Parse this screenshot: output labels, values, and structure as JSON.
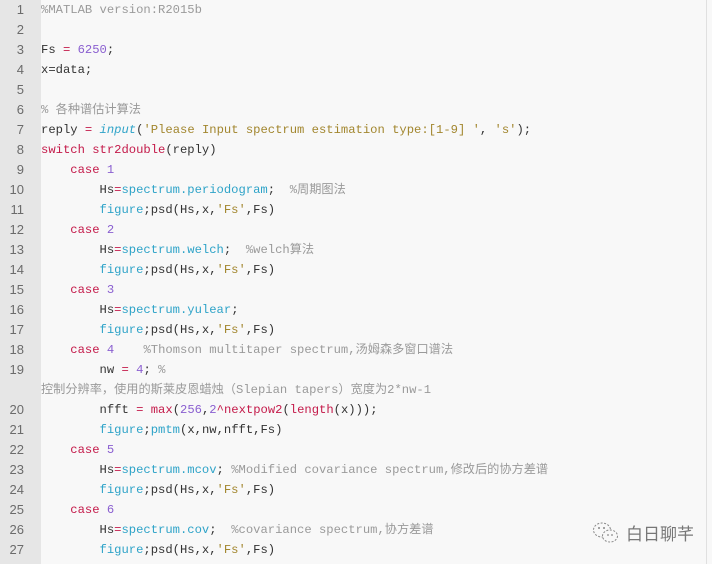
{
  "lines": [
    {
      "n": "1",
      "tokens": [
        [
          "com",
          "%MATLAB version:R2015b"
        ]
      ]
    },
    {
      "n": "2",
      "tokens": []
    },
    {
      "n": "3",
      "tokens": [
        [
          "txt",
          "Fs "
        ],
        [
          "op",
          "="
        ],
        [
          "txt",
          " "
        ],
        [
          "num",
          "6250"
        ],
        [
          "txt",
          ";"
        ]
      ]
    },
    {
      "n": "4",
      "tokens": [
        [
          "txt",
          "x=data;"
        ]
      ]
    },
    {
      "n": "5",
      "tokens": []
    },
    {
      "n": "6",
      "tokens": [
        [
          "com",
          "% 各种谱估计算法"
        ]
      ]
    },
    {
      "n": "7",
      "tokens": [
        [
          "txt",
          "reply "
        ],
        [
          "op",
          "="
        ],
        [
          "txt",
          " "
        ],
        [
          "it",
          "input"
        ],
        [
          "txt",
          "("
        ],
        [
          "str",
          "'Please Input spectrum estimation type:[1-9] '"
        ],
        [
          "txt",
          ", "
        ],
        [
          "str",
          "'s'"
        ],
        [
          "txt",
          ");"
        ]
      ]
    },
    {
      "n": "8",
      "tokens": [
        [
          "kw",
          "switch"
        ],
        [
          "txt",
          " "
        ],
        [
          "kw",
          "str2double"
        ],
        [
          "txt",
          "(reply)"
        ]
      ]
    },
    {
      "n": "9",
      "tokens": [
        [
          "txt",
          "    "
        ],
        [
          "kw",
          "case"
        ],
        [
          "txt",
          " "
        ],
        [
          "num",
          "1"
        ]
      ]
    },
    {
      "n": "10",
      "tokens": [
        [
          "txt",
          "        Hs"
        ],
        [
          "op",
          "="
        ],
        [
          "fn",
          "spectrum.periodogram"
        ],
        [
          "txt",
          ";  "
        ],
        [
          "com",
          "%周期图法"
        ]
      ]
    },
    {
      "n": "11",
      "tokens": [
        [
          "txt",
          "        "
        ],
        [
          "fn",
          "figure"
        ],
        [
          "txt",
          ";psd(Hs,x,"
        ],
        [
          "str",
          "'Fs'"
        ],
        [
          "txt",
          ",Fs)"
        ]
      ]
    },
    {
      "n": "12",
      "tokens": [
        [
          "txt",
          "    "
        ],
        [
          "kw",
          "case"
        ],
        [
          "txt",
          " "
        ],
        [
          "num",
          "2"
        ]
      ]
    },
    {
      "n": "13",
      "tokens": [
        [
          "txt",
          "        Hs"
        ],
        [
          "op",
          "="
        ],
        [
          "fn",
          "spectrum.welch"
        ],
        [
          "txt",
          ";  "
        ],
        [
          "com",
          "%welch算法"
        ]
      ]
    },
    {
      "n": "14",
      "tokens": [
        [
          "txt",
          "        "
        ],
        [
          "fn",
          "figure"
        ],
        [
          "txt",
          ";psd(Hs,x,"
        ],
        [
          "str",
          "'Fs'"
        ],
        [
          "txt",
          ",Fs)"
        ]
      ]
    },
    {
      "n": "15",
      "tokens": [
        [
          "txt",
          "    "
        ],
        [
          "kw",
          "case"
        ],
        [
          "txt",
          " "
        ],
        [
          "num",
          "3"
        ]
      ]
    },
    {
      "n": "16",
      "tokens": [
        [
          "txt",
          "        Hs"
        ],
        [
          "op",
          "="
        ],
        [
          "fn",
          "spectrum.yulear"
        ],
        [
          "txt",
          ";"
        ]
      ]
    },
    {
      "n": "17",
      "tokens": [
        [
          "txt",
          "        "
        ],
        [
          "fn",
          "figure"
        ],
        [
          "txt",
          ";psd(Hs,x,"
        ],
        [
          "str",
          "'Fs'"
        ],
        [
          "txt",
          ",Fs)"
        ]
      ]
    },
    {
      "n": "18",
      "tokens": [
        [
          "txt",
          "    "
        ],
        [
          "kw",
          "case"
        ],
        [
          "txt",
          " "
        ],
        [
          "num",
          "4"
        ],
        [
          "txt",
          "    "
        ],
        [
          "com",
          "%Thomson multitaper spectrum,汤姆森多窗口谱法"
        ]
      ]
    },
    {
      "n": "19",
      "tokens": [
        [
          "txt",
          "        nw "
        ],
        [
          "op",
          "="
        ],
        [
          "txt",
          " "
        ],
        [
          "num",
          "4"
        ],
        [
          "txt",
          "; "
        ],
        [
          "com",
          "%"
        ]
      ]
    },
    {
      "n": "",
      "tokens": [
        [
          "com",
          "控制分辨率，使用的斯莱皮恩蜡烛（Slepian tapers）宽度为2*nw-1"
        ]
      ]
    },
    {
      "n": "20",
      "tokens": [
        [
          "txt",
          "        nfft "
        ],
        [
          "op",
          "="
        ],
        [
          "txt",
          " "
        ],
        [
          "kw",
          "max"
        ],
        [
          "txt",
          "("
        ],
        [
          "num",
          "256"
        ],
        [
          "txt",
          ","
        ],
        [
          "num",
          "2"
        ],
        [
          "kw",
          "^nextpow2"
        ],
        [
          "txt",
          "("
        ],
        [
          "kw",
          "length"
        ],
        [
          "txt",
          "(x)));"
        ]
      ]
    },
    {
      "n": "21",
      "tokens": [
        [
          "txt",
          "        "
        ],
        [
          "fn",
          "figure"
        ],
        [
          "txt",
          ";"
        ],
        [
          "fn",
          "pmtm"
        ],
        [
          "txt",
          "(x,nw,nfft,Fs)"
        ]
      ]
    },
    {
      "n": "22",
      "tokens": [
        [
          "txt",
          "    "
        ],
        [
          "kw",
          "case"
        ],
        [
          "txt",
          " "
        ],
        [
          "num",
          "5"
        ]
      ]
    },
    {
      "n": "23",
      "tokens": [
        [
          "txt",
          "        Hs"
        ],
        [
          "op",
          "="
        ],
        [
          "fn",
          "spectrum.mcov"
        ],
        [
          "txt",
          "; "
        ],
        [
          "com",
          "%Modified covariance spectrum,修改后的协方差谱"
        ]
      ]
    },
    {
      "n": "24",
      "tokens": [
        [
          "txt",
          "        "
        ],
        [
          "fn",
          "figure"
        ],
        [
          "txt",
          ";psd(Hs,x,"
        ],
        [
          "str",
          "'Fs'"
        ],
        [
          "txt",
          ",Fs)"
        ]
      ]
    },
    {
      "n": "25",
      "tokens": [
        [
          "txt",
          "    "
        ],
        [
          "kw",
          "case"
        ],
        [
          "txt",
          " "
        ],
        [
          "num",
          "6"
        ]
      ]
    },
    {
      "n": "26",
      "tokens": [
        [
          "txt",
          "        Hs"
        ],
        [
          "op",
          "="
        ],
        [
          "fn",
          "spectrum.cov"
        ],
        [
          "txt",
          ";  "
        ],
        [
          "com",
          "%covariance spectrum,协方差谱"
        ]
      ]
    },
    {
      "n": "27",
      "tokens": [
        [
          "txt",
          "        "
        ],
        [
          "fn",
          "figure"
        ],
        [
          "txt",
          ";psd(Hs,x,"
        ],
        [
          "str",
          "'Fs'"
        ],
        [
          "txt",
          ",Fs)"
        ]
      ]
    }
  ],
  "watermark": {
    "text": "白日聊芊",
    "icon": "wechat-icon"
  }
}
